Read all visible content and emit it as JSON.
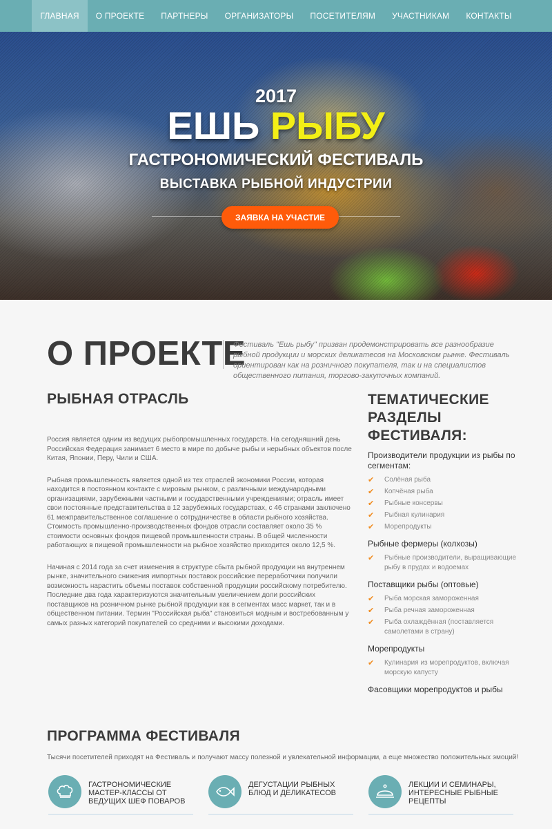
{
  "nav": {
    "items": [
      "Главная",
      "О проекте",
      "Партнеры",
      "Организаторы",
      "Посетителям",
      "Участникам",
      "Контакты"
    ]
  },
  "hero": {
    "year": "2017",
    "title_part1": "ЕШЬ",
    "title_part2": "РЫБУ",
    "subtitle1": "ГАСТРОНОМИЧЕСКИЙ ФЕСТИВАЛЬ",
    "subtitle2": "ВЫСТАВКА РЫБНОЙ ИНДУСТРИИ",
    "cta_label": "ЗАЯВКА НА УЧАСТИЕ"
  },
  "about": {
    "title": "О ПРОЕКТЕ",
    "description": "Фестиваль \"Ешь рыбу\" призван продемонстрировать все разнообразие рыбной продукции и морских деликатесов на Московском рынке. Фестиваль ориентирован как на розничного покупателя, так и на специалистов общественного питания, торгово-закупочных компаний."
  },
  "fishery": {
    "title": "РЫБНАЯ ОТРАСЛЬ",
    "paragraphs": [
      "Россия является одним из ведущих рыбопромышленных государств. На сегодняшний день Российская Федерация занимает 6 место в мире по добыче рыбы и нерыбных объектов после Китая, Японии, Перу, Чили и США.",
      "Рыбная промышленность является одной из тех отраслей экономики России, которая находится в постоянном контакте с мировым рынком, с различными международными организациями, зарубежными частными и государственными учреждениями; отрасль имеет свои постоянные представительства в 12 зарубежных государствах, с 46 странами заключено 61 межправительственное соглашение о сотрудничестве в области рыбного хозяйства. Стоимость промышленно-производственных фондов отрасли составляет около 35 % стоимости основных фондов пищевой промышленности страны. В общей численности работающих в пищевой промышленности на рыбное хозяйство приходится около 12,5 %.",
      "Начиная с 2014 года за счет изменения в структуре сбыта рыбной продукции на внутреннем рынке, значительного снижения импортных поставок российские переработчики получили возможность нарастить объемы поставок собственной продукции российскому потребителю. Последние два года характеризуются значительным увеличением доли российских поставщиков на розничном рынке рыбной продукции как в сегментах масс маркет, так и в общественном питании. Термин \"Российская рыба\" становиться модным и востребованным у самых разных категорий покупателей со средними и высокими доходами."
    ]
  },
  "sections": {
    "title": "ТЕМАТИЧЕСКИЕ РАЗДЕЛЫ ФЕСТИВАЛЯ:",
    "groups": [
      {
        "title": "Производители продукции из рыбы по сегментам:",
        "items": [
          "Солёная рыба",
          "Копчёная рыба",
          "Рыбные консервы",
          "Рыбная кулинария",
          "Морепродукты"
        ]
      },
      {
        "title": "Рыбные фермеры (колхозы)",
        "items": [
          "Рыбные производители, выращивающие рыбу в прудах и водоемах"
        ]
      },
      {
        "title": "Поставщики рыбы (оптовые)",
        "items": [
          "Рыба морская замороженная",
          "Рыба речная замороженная",
          "Рыба охлаждённая (поставляется самолетами в страну)"
        ]
      },
      {
        "title": "Морепродукты",
        "items": [
          "Кулинария из морепродуктов, включая морскую капусту"
        ]
      },
      {
        "title": "Фасовщики морепродуктов и рыбы",
        "items": []
      }
    ]
  },
  "program": {
    "title": "ПРОГРАММА ФЕСТИВАЛЯ",
    "description": "Тысячи посетителей приходят на Фестиваль и получают массу полезной и увлекательной информации, а еще множество положительных эмоций!",
    "items": [
      {
        "label": "ГАСТРОНОМИЧЕСКИЕ МАСТЕР-КЛАССЫ ОТ ВЕДУЩИХ ШЕФ ПОВАРОВ",
        "icon": "chef-hat-icon"
      },
      {
        "label": "ДЕГУСТАЦИИ РЫБНЫХ БЛЮД И ДЕЛИКАТЕСОВ",
        "icon": "fish-icon"
      },
      {
        "label": "ЛЕКЦИИ И СЕМИНАРЫ, ИНТЕРЕСНЫЕ РЫБНЫЕ РЕЦЕПТЫ",
        "icon": "cloche-icon"
      }
    ]
  },
  "colors": {
    "nav": "#6aaeb3",
    "accent_yellow": "#f3ef16",
    "cta": "#ff5b0a",
    "check": "#f08a1c"
  }
}
